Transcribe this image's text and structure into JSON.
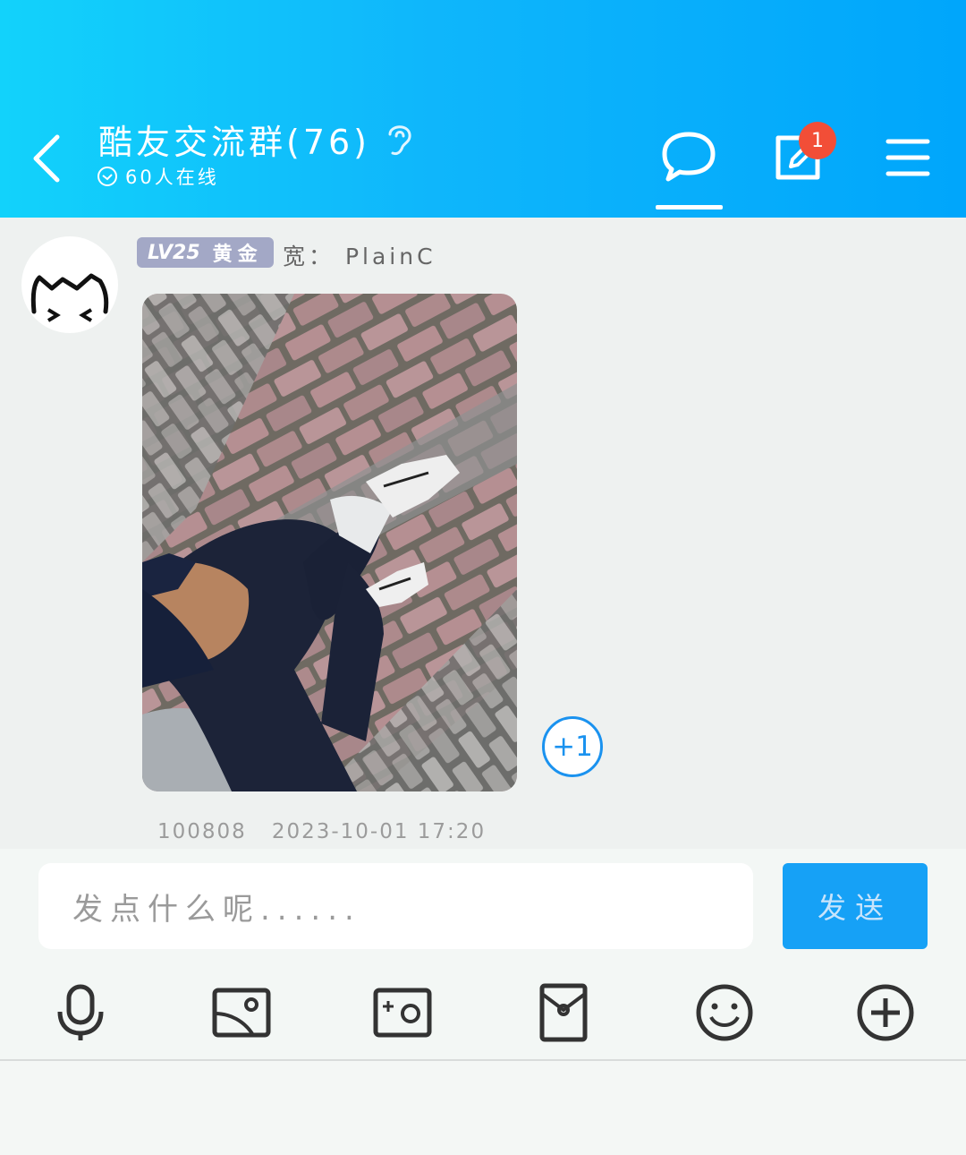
{
  "header": {
    "title": "酷友交流群(76)",
    "online_text": "60人在线",
    "notes_badge": "1"
  },
  "message": {
    "level": "LV25",
    "rank": "黄金",
    "sender": "宽： PlainC",
    "plus_one": "+1",
    "user_id": "100808",
    "timestamp": "2023-10-01 17:20"
  },
  "composer": {
    "placeholder": "发点什么呢......",
    "send_label": "发送"
  },
  "toolbar": {
    "icons": [
      "microphone-icon",
      "image-icon",
      "camera-icon",
      "red-packet-icon",
      "emoji-icon",
      "plus-icon"
    ]
  },
  "colors": {
    "header_gradient_start": "#12d2fb",
    "header_gradient_end": "#00a6fb",
    "send_button": "#16a1f6",
    "badge": "#f24e37",
    "level_badge": "#a3a8c6"
  }
}
